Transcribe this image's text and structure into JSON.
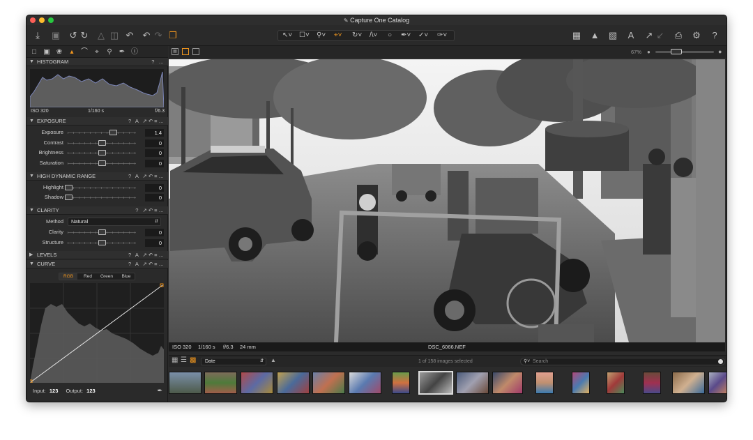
{
  "window": {
    "title": "Capture One Catalog"
  },
  "toolbar": {
    "left_icons": [
      "import-icon",
      "camera-icon",
      "rotate-left-icon",
      "rotate-right-icon",
      "copy-adjustments-icon",
      "delete-icon",
      "reset-icon",
      "undo-icon",
      "redo-icon",
      "variants-icon"
    ],
    "cursor_tools": [
      "pointer-tool",
      "pan-tool",
      "zoom-tool",
      "crop-tool",
      "rotate-tool",
      "keystone-tool",
      "spot-tool",
      "brush-tool",
      "picker-tool",
      "annotate-tool"
    ],
    "right_icons": [
      "grid-icon",
      "exposure-warning-icon",
      "grid-overlay-icon",
      "text-icon",
      "export-icon",
      "print-icon",
      "settings-icon",
      "help-icon"
    ],
    "help_glyph": "?"
  },
  "left_panel": {
    "tool_tabs": [
      "library-icon",
      "capture-icon",
      "color-icon",
      "exposure-tab-icon",
      "lens-icon",
      "composition-icon",
      "details-icon",
      "local-adjust-icon",
      "metadata-icon"
    ],
    "histogram": {
      "title": "HISTOGRAM",
      "iso": "ISO 320",
      "shutter": "1/160 s",
      "aperture": "f/6.3",
      "help": "?",
      "more": "…"
    },
    "exposure": {
      "title": "EXPOSURE",
      "help": "?",
      "auto": "A",
      "more": "…",
      "sliders": [
        {
          "label": "Exposure",
          "value": "1.4",
          "level": 0.66
        },
        {
          "label": "Contrast",
          "value": "0",
          "level": 0.5
        },
        {
          "label": "Brightness",
          "value": "0",
          "level": 0.5
        },
        {
          "label": "Saturation",
          "value": "0",
          "level": 0.5
        }
      ]
    },
    "hdr": {
      "title": "HIGH DYNAMIC RANGE",
      "help": "?",
      "auto": "A",
      "more": "…",
      "sliders": [
        {
          "label": "Highlight",
          "value": "0",
          "level": 0.0
        },
        {
          "label": "Shadow",
          "value": "0",
          "level": 0.0
        }
      ]
    },
    "clarity": {
      "title": "CLARITY",
      "help": "?",
      "more": "…",
      "method_label": "Method",
      "method_value": "Natural",
      "sliders": [
        {
          "label": "Clarity",
          "value": "0",
          "level": 0.5
        },
        {
          "label": "Structure",
          "value": "0",
          "level": 0.5
        }
      ]
    },
    "levels": {
      "title": "LEVELS",
      "help": "?",
      "auto": "A",
      "more": "…"
    },
    "curve": {
      "title": "CURVE",
      "help": "?",
      "auto": "A",
      "more": "…",
      "channels": [
        "RGB",
        "Red",
        "Green",
        "Blue"
      ],
      "active_channel": "RGB",
      "input_label": "Input:",
      "input_value": "123",
      "output_label": "Output:",
      "output_value": "123"
    }
  },
  "viewer": {
    "zoom": "67%",
    "caption": {
      "iso": "ISO 320",
      "shutter": "1/160 s",
      "aperture": "f/6.3",
      "focal": "24 mm",
      "filename": "DSC_6066.NEF"
    }
  },
  "browser": {
    "sort_value": "Date",
    "count_text": "1 of 158 images selected",
    "search_placeholder": "Search",
    "thumbnails": 17,
    "selected_index": 9
  },
  "colors": {
    "accent": "#f0961e",
    "panel": "#2a2a2a",
    "header": "#2f2f2f"
  }
}
